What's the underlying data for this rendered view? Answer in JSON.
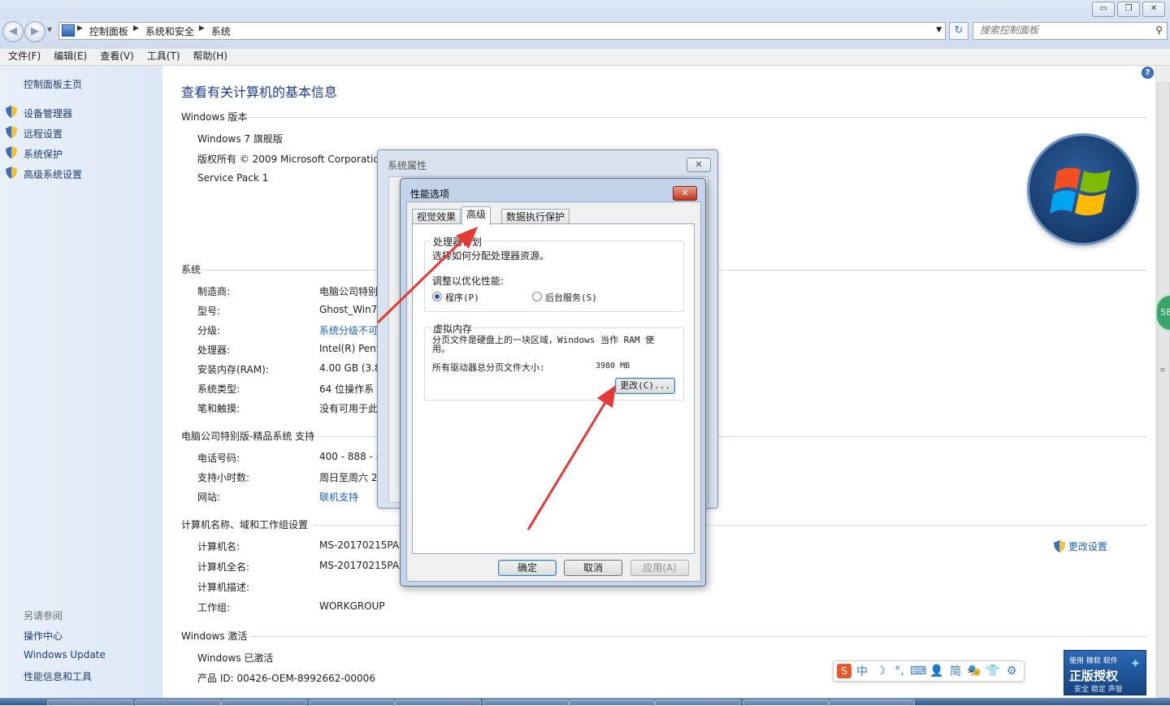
{
  "addressbar": {
    "crumbs": [
      "控制面板",
      "系统和安全",
      "系统"
    ],
    "search_placeholder": "搜索控制面板"
  },
  "menubar": [
    "文件(F)",
    "编辑(E)",
    "查看(V)",
    "工具(T)",
    "帮助(H)"
  ],
  "sidebar": {
    "home": "控制面板主页",
    "tasks": [
      "设备管理器",
      "远程设置",
      "系统保护",
      "高级系统设置"
    ],
    "see_also_title": "另请参阅",
    "see_also": [
      "操作中心",
      "Windows Update",
      "性能信息和工具"
    ]
  },
  "main": {
    "heading": "查看有关计算机的基本信息",
    "edition": {
      "title": "Windows 版本",
      "lines": [
        "Windows 7 旗舰版",
        "版权所有 © 2009 Microsoft Corporatic",
        "Service Pack 1"
      ]
    },
    "system": {
      "title": "系统",
      "rows": [
        {
          "label": "制造商:",
          "value": "电脑公司特别"
        },
        {
          "label": "型号:",
          "value": "Ghost_Win7"
        },
        {
          "label": "分级:",
          "value": "系统分级不可"
        },
        {
          "label": "处理器:",
          "value": "Intel(R) Pent"
        },
        {
          "label": "安装内存(RAM):",
          "value": "4.00 GB (3.8"
        },
        {
          "label": "系统类型:",
          "value": "64 位操作系"
        },
        {
          "label": "笔和触摸:",
          "value": "没有可用于此"
        }
      ]
    },
    "support": {
      "title": "电脑公司特别版-精品系统 支持",
      "rows": [
        {
          "label": "电话号码:",
          "value": "400 - 888 - 8"
        },
        {
          "label": "支持小时数:",
          "value": "周日至周六  2"
        },
        {
          "label": "网站:",
          "value": "联机支持"
        }
      ]
    },
    "computer": {
      "title": "计算机名称、域和工作组设置",
      "rows": [
        {
          "label": "计算机名:",
          "value": "MS-20170215PAA"
        },
        {
          "label": "计算机全名:",
          "value": "MS-20170215PAA"
        },
        {
          "label": "计算机描述:",
          "value": ""
        },
        {
          "label": "工作组:",
          "value": "WORKGROUP"
        }
      ],
      "change_settings": "更改设置"
    },
    "activation": {
      "title": "Windows 激活",
      "status": "Windows 已激活",
      "product_id": "产品 ID: 00426-OEM-8992662-00006"
    }
  },
  "sysprops_dialog": {
    "title": "系统属性",
    "close": "✕"
  },
  "perf_dialog": {
    "title": "性能选项",
    "close": "✕",
    "tabs": [
      "视觉效果",
      "高级",
      "数据执行保护"
    ],
    "active_tab": "高级",
    "processor": {
      "group_title": "处理器计划",
      "desc": "选择如何分配处理器资源。",
      "adjust_label": "调整以优化性能:",
      "option_programs": "程序(P)",
      "option_services": "后台服务(S)",
      "selected": "程序(P)"
    },
    "vm": {
      "group_title": "虚拟内存",
      "desc": "分页文件是硬盘上的一块区域，Windows 当作 RAM 使用。",
      "total_label": "所有驱动器总分页文件大小:",
      "total_value": "3980 MB",
      "change_button": "更改(C)..."
    },
    "buttons": {
      "ok": "确定",
      "cancel": "取消",
      "apply": "应用(A)"
    }
  },
  "ime_toolbar": {
    "items": [
      "中",
      "☽",
      "°,",
      "⌨",
      "👤",
      "简",
      "🎭",
      "👕",
      "⚙"
    ]
  },
  "genuine_badge": {
    "small": "使用 微软 软件",
    "big": "正版授权",
    "tiny": "安全 稳定 声誉"
  },
  "badge_side": "58",
  "colors": {
    "link": "#1b63b8",
    "heading": "#1e3d8f",
    "arrow": "#e53935"
  }
}
